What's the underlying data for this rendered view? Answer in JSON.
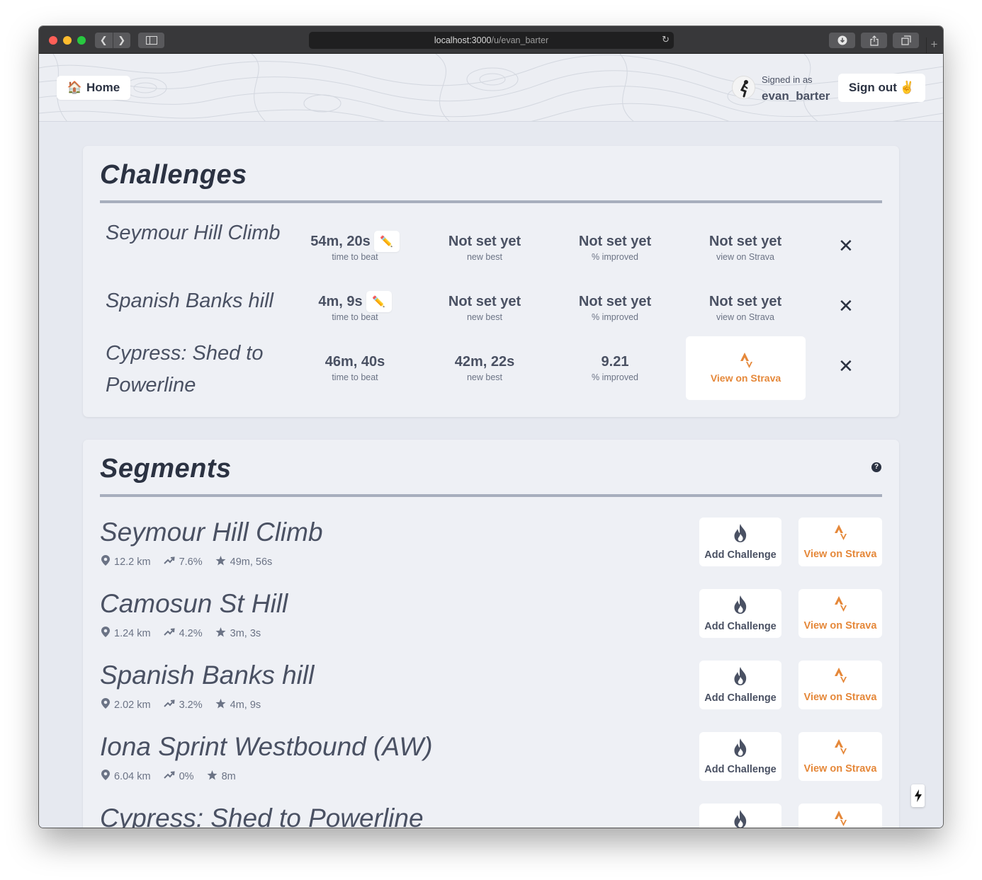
{
  "browser": {
    "url_host": "localhost:3000",
    "url_path": "/u/evan_barter"
  },
  "header": {
    "home_label": "Home",
    "home_emoji": "🏠",
    "signed_in_label": "Signed in as",
    "username": "evan_barter",
    "sign_out_label": "Sign out",
    "sign_out_emoji": "✌️"
  },
  "challenges": {
    "title": "Challenges",
    "rows": [
      {
        "name": "Seymour Hill Climb",
        "time_to_beat": "54m, 20s",
        "time_to_beat_sub": "time to beat",
        "new_best": "Not set yet",
        "new_best_sub": "new best",
        "improved": "Not set yet",
        "improved_sub": "% improved",
        "strava": "Not set yet",
        "strava_sub": "view on Strava"
      },
      {
        "name": "Spanish Banks hill",
        "time_to_beat": "4m, 9s",
        "time_to_beat_sub": "time to beat",
        "new_best": "Not set yet",
        "new_best_sub": "new best",
        "improved": "Not set yet",
        "improved_sub": "% improved",
        "strava": "Not set yet",
        "strava_sub": "view on Strava"
      },
      {
        "name": "Cypress: Shed to Powerline",
        "time_to_beat": "46m, 40s",
        "time_to_beat_sub": "time to beat",
        "new_best": "42m, 22s",
        "new_best_sub": "new best",
        "improved": "9.21",
        "improved_sub": "% improved",
        "strava_button": "View on Strava"
      }
    ]
  },
  "segments": {
    "title": "Segments",
    "add_label": "Add Challenge",
    "strava_label": "View on Strava",
    "rows": [
      {
        "name": "Seymour Hill Climb",
        "distance": "12.2 km",
        "grade": "7.6%",
        "best": "49m, 56s"
      },
      {
        "name": "Camosun St Hill",
        "distance": "1.24 km",
        "grade": "4.2%",
        "best": "3m, 3s"
      },
      {
        "name": "Spanish Banks hill",
        "distance": "2.02 km",
        "grade": "3.2%",
        "best": "4m, 9s"
      },
      {
        "name": "Iona Sprint Westbound (AW)",
        "distance": "6.04 km",
        "grade": "0%",
        "best": "8m"
      },
      {
        "name": "Cypress: Shed to Powerline",
        "distance": "",
        "grade": "",
        "best": ""
      }
    ]
  },
  "colors": {
    "text_dark": "#2b3242",
    "text_muted": "#4a5163",
    "strava_orange": "#e5883a",
    "page_bg": "#e6e9f0"
  }
}
